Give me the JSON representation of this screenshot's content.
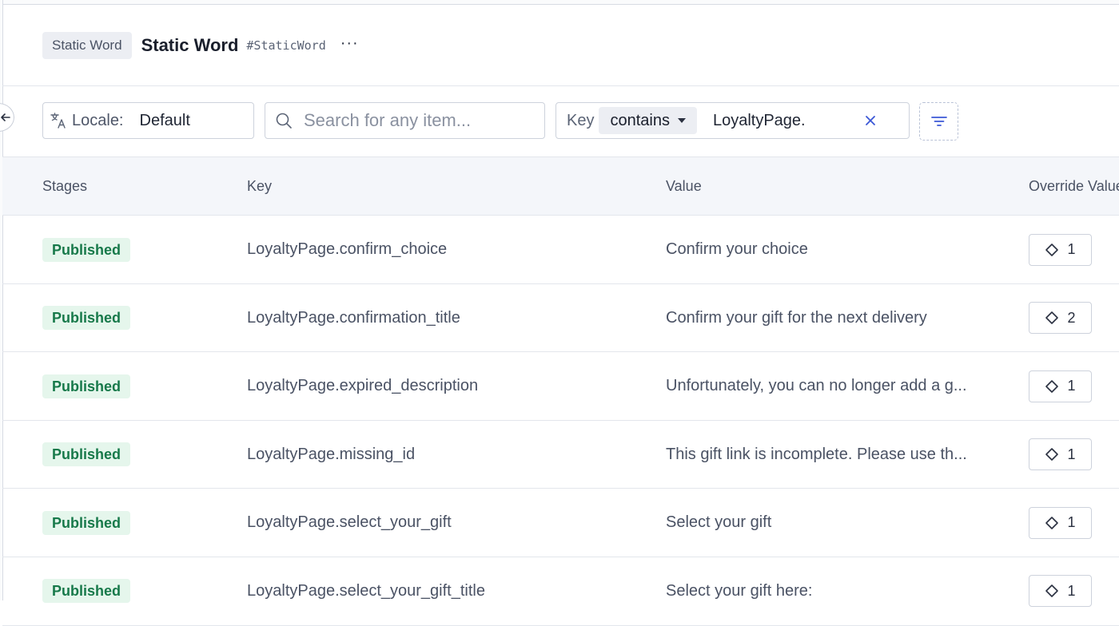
{
  "header": {
    "model_name": "Static Word",
    "title": "Static Word",
    "api_id": "#StaticWord",
    "more_label": "···"
  },
  "toolbar": {
    "locale_label": "Locale:",
    "locale_value": "Default",
    "search_placeholder": "Search for any item...",
    "filter_field": "Key",
    "filter_operator": "contains",
    "filter_value": "LoyaltyPage."
  },
  "table": {
    "columns": {
      "stages": "Stages",
      "key": "Key",
      "value": "Value",
      "override": "Override Value"
    },
    "rows": [
      {
        "stage": "Published",
        "key": "LoyaltyPage.confirm_choice",
        "value": "Confirm your choice",
        "override": "1"
      },
      {
        "stage": "Published",
        "key": "LoyaltyPage.confirmation_title",
        "value": "Confirm your gift for the next delivery",
        "override": "2"
      },
      {
        "stage": "Published",
        "key": "LoyaltyPage.expired_description",
        "value": "Unfortunately, you can no longer add a g...",
        "override": "1"
      },
      {
        "stage": "Published",
        "key": "LoyaltyPage.missing_id",
        "value": "This gift link is incomplete. Please use th...",
        "override": "1"
      },
      {
        "stage": "Published",
        "key": "LoyaltyPage.select_your_gift",
        "value": "Select your gift",
        "override": "1"
      },
      {
        "stage": "Published",
        "key": "LoyaltyPage.select_your_gift_title",
        "value": "Select your gift here:",
        "override": "1"
      }
    ]
  },
  "colors": {
    "published_bg": "#e5f6ec",
    "published_text": "#17794a",
    "header_bg": "#f4f6fa",
    "border": "#cdd2dc"
  }
}
